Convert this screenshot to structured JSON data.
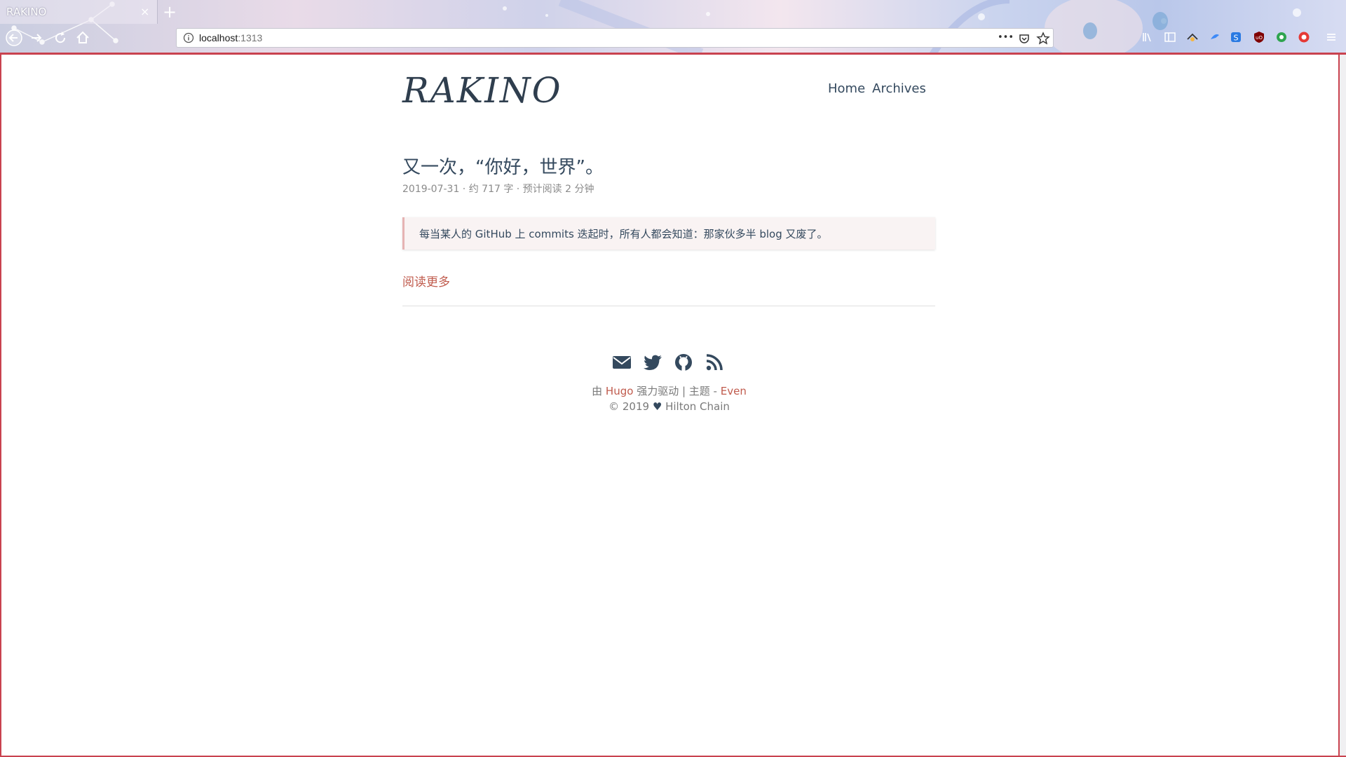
{
  "browser": {
    "tab_title": "RAKINO",
    "tab_close": "×",
    "new_tab": "+",
    "url_host": "localhost",
    "url_port": ":1313",
    "overflow_menu": "•••"
  },
  "site": {
    "logo": "RAKINO",
    "nav": [
      {
        "label": "Home"
      },
      {
        "label": "Archives"
      }
    ]
  },
  "post": {
    "title": "又一次，“你好，世界”。",
    "meta": "2019-07-31 · 约 717 字 · 预计阅读 2 分钟",
    "summary": "每当某人的 GitHub 上 commits 迭起时，所有人都会知道：那家伙多半 blog 又废了。",
    "read_more": "阅读更多"
  },
  "footer": {
    "social": [
      "email-icon",
      "twitter-icon",
      "github-icon",
      "rss-icon"
    ],
    "powered_prefix": "由",
    "powered_link": "Hugo",
    "powered_middle": "强力驱动 | 主题 -",
    "theme_link": "Even",
    "copyright_year": "© 2019",
    "heart": "♥",
    "author": "Hilton Chain"
  },
  "colors": {
    "accent": "#c05b4d",
    "text": "#34495e",
    "frame": "#c9424f"
  }
}
